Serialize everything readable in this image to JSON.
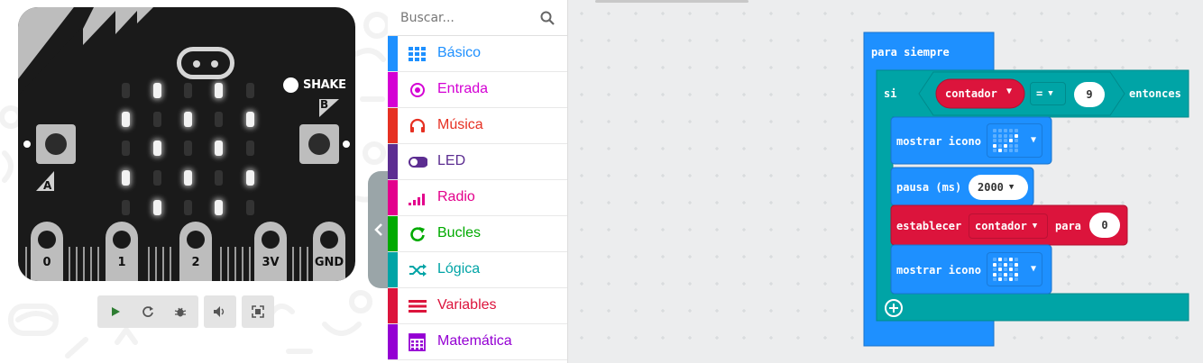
{
  "simulator": {
    "shake_label": "SHAKE",
    "button_a_label": "A",
    "button_b_label": "B",
    "pins": [
      "0",
      "1",
      "2",
      "3V",
      "GND"
    ],
    "led_matrix": [
      [
        0,
        1,
        0,
        1,
        0
      ],
      [
        1,
        0,
        1,
        0,
        1
      ],
      [
        0,
        1,
        0,
        1,
        0
      ],
      [
        1,
        0,
        1,
        0,
        1
      ],
      [
        0,
        1,
        0,
        1,
        0
      ]
    ],
    "controls": [
      "play-icon",
      "restart-icon",
      "debug-icon",
      "sound-icon",
      "fullscreen-icon"
    ]
  },
  "toolbox": {
    "search_placeholder": "Buscar...",
    "categories": [
      {
        "label": "Básico",
        "color": "#1e90ff",
        "icon": "grid-icon"
      },
      {
        "label": "Entrada",
        "color": "#d400d4",
        "icon": "target-icon"
      },
      {
        "label": "Música",
        "color": "#e63022",
        "icon": "headphones-icon"
      },
      {
        "label": "LED",
        "color": "#5c2d91",
        "icon": "toggle-icon"
      },
      {
        "label": "Radio",
        "color": "#e3008c",
        "icon": "signal-icon"
      },
      {
        "label": "Bucles",
        "color": "#00aa00",
        "icon": "refresh-icon"
      },
      {
        "label": "Lógica",
        "color": "#00a4a6",
        "icon": "shuffle-icon"
      },
      {
        "label": "Variables",
        "color": "#dc143c",
        "icon": "list-icon"
      },
      {
        "label": "Matemática",
        "color": "#9400d3",
        "icon": "calculator-icon"
      }
    ]
  },
  "workspace": {
    "forever_label": "para siempre",
    "if_label": "si",
    "then_label": "entonces",
    "compare_var": "contador",
    "compare_op": "=",
    "compare_value": "9",
    "show_icon_label": "mostrar icono",
    "pause_label": "pausa (ms)",
    "pause_value": "2000",
    "set_label": "establecer",
    "set_var": "contador",
    "set_to_label": "para",
    "set_value": "0",
    "icon1_pattern": [
      [
        0,
        0,
        0,
        0,
        0
      ],
      [
        0,
        0,
        0,
        0,
        1
      ],
      [
        0,
        0,
        0,
        1,
        0
      ],
      [
        1,
        0,
        1,
        0,
        0
      ],
      [
        0,
        1,
        0,
        0,
        0
      ]
    ],
    "icon2_pattern": [
      [
        0,
        1,
        0,
        1,
        0
      ],
      [
        1,
        0,
        1,
        0,
        1
      ],
      [
        0,
        1,
        0,
        1,
        0
      ],
      [
        1,
        0,
        1,
        0,
        1
      ],
      [
        0,
        1,
        0,
        1,
        0
      ]
    ],
    "colors": {
      "basic": "#1e90ff",
      "logic": "#00a4a6",
      "variables": "#dc143c"
    }
  }
}
